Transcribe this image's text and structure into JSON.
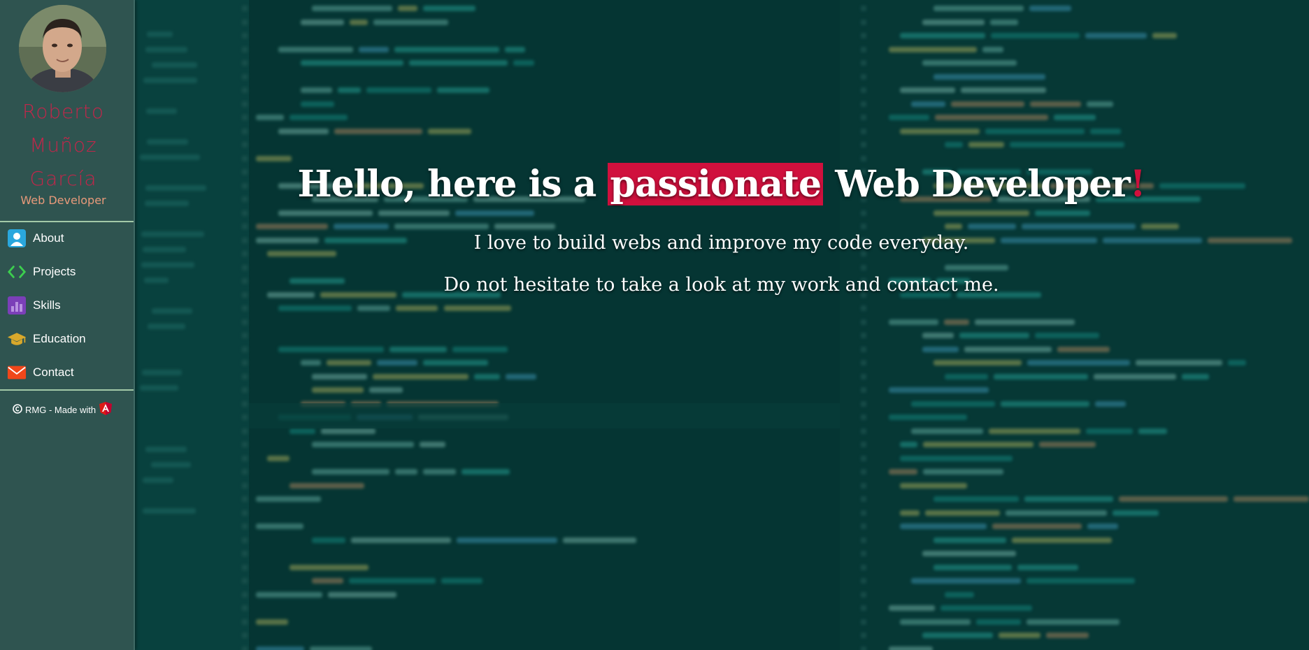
{
  "sidebar": {
    "name_lines": [
      "Roberto",
      "Muñoz",
      "García"
    ],
    "role": "Web Developer",
    "nav": [
      {
        "label": "About",
        "icon": "user-icon"
      },
      {
        "label": "Projects",
        "icon": "code-icon"
      },
      {
        "label": "Skills",
        "icon": "bar-chart-icon"
      },
      {
        "label": "Education",
        "icon": "graduation-cap-icon"
      },
      {
        "label": "Contact",
        "icon": "envelope-icon"
      }
    ],
    "footer": "RMG - Made with",
    "footer_icons": [
      "copyright-icon",
      "angular-logo-icon"
    ]
  },
  "hero": {
    "headline_pre": "Hello, here is a",
    "headline_highlight": "passionate",
    "headline_post": "Web Developer",
    "headline_bang": "!",
    "line1": "I love to build webs and improve my code everyday.",
    "line2": "Do not hesitate to take a look at my work and contact me."
  },
  "colors": {
    "accent": "#d0103d",
    "name": "#c2264a",
    "role": "#e89a7a",
    "sidebar_bg": "#2f5450",
    "page_bg": "#063a38"
  }
}
